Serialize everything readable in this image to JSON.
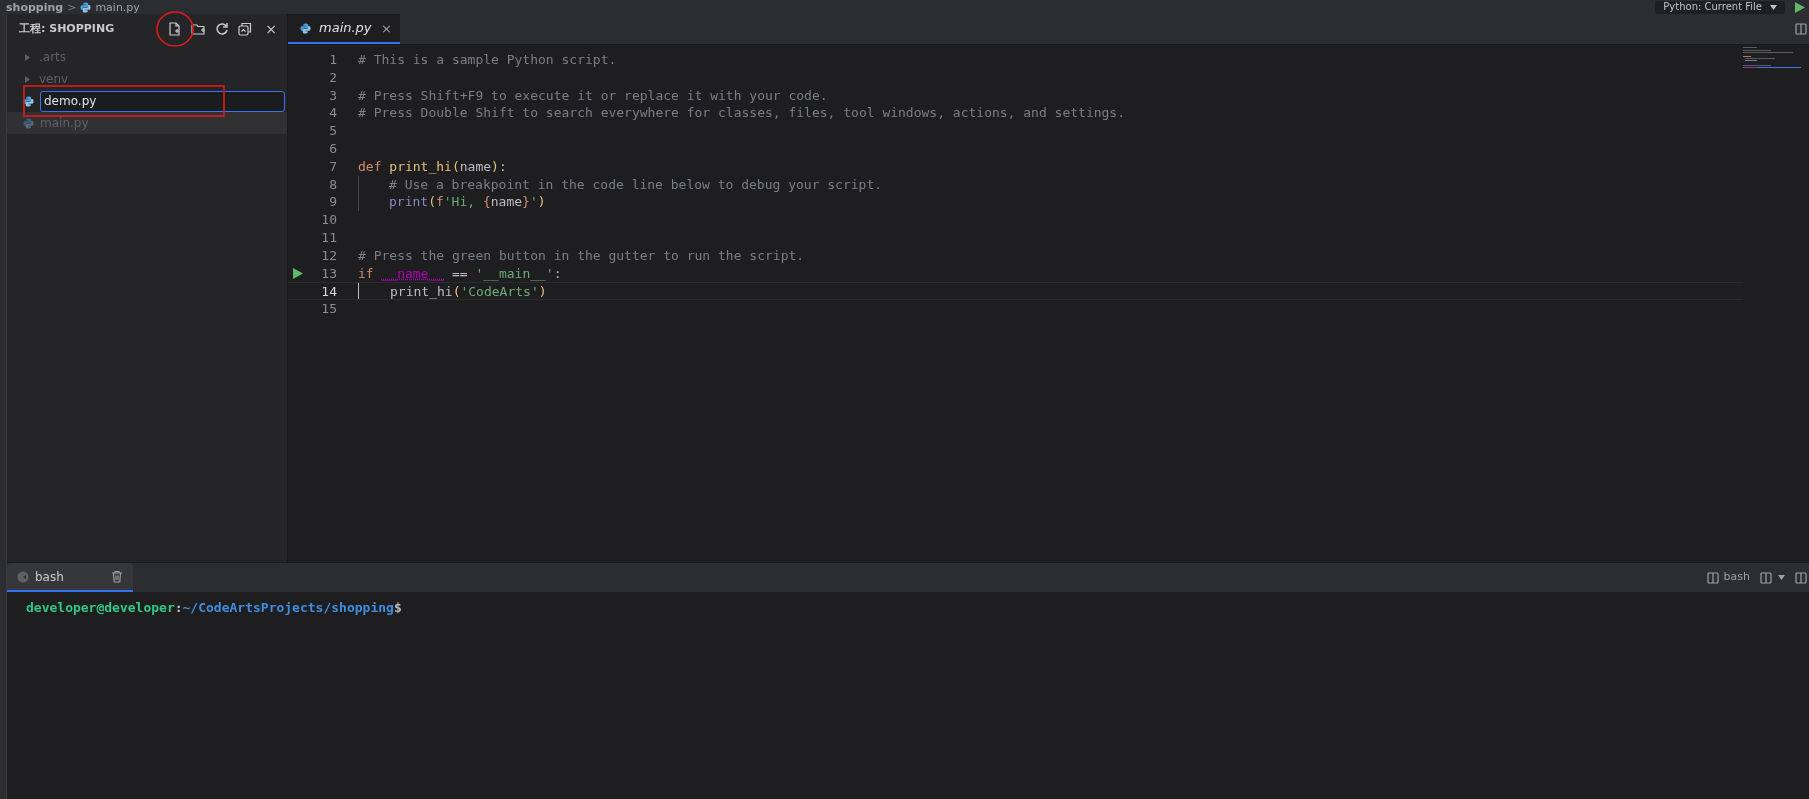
{
  "breadcrumb": {
    "folder": "shopping",
    "separator": ">",
    "file": "main.py"
  },
  "run_config": {
    "label": "Python: Current File"
  },
  "explorer": {
    "title": "工程: SHOPPING",
    "close": "×",
    "items": [
      {
        "kind": "folder",
        "name": ".arts",
        "selected": false
      },
      {
        "kind": "folder",
        "name": "venv",
        "selected": false
      },
      {
        "kind": "rename",
        "value": "demo.py",
        "selected": false
      },
      {
        "kind": "file",
        "name": "main.py",
        "selected": true
      }
    ]
  },
  "editor": {
    "tabs": [
      {
        "label": "main.py",
        "selected": true,
        "close": "×"
      }
    ],
    "lines": [
      {
        "number": "1",
        "current": false,
        "run_marker": false,
        "indented": false,
        "tokens": [
          {
            "kind": "comment",
            "text": "# This is a sample Python script."
          }
        ]
      },
      {
        "number": "2",
        "current": false,
        "run_marker": false
      },
      {
        "number": "3",
        "current": false,
        "run_marker": false,
        "indented": false,
        "tokens": [
          {
            "kind": "comment",
            "text": "# Press Shift+F9 to execute it or replace it with your code."
          }
        ]
      },
      {
        "number": "4",
        "current": false,
        "run_marker": false,
        "indented": false,
        "tokens": [
          {
            "kind": "comment",
            "text": "# Press Double Shift to search everywhere for classes, files, tool windows, actions, and settings."
          }
        ]
      },
      {
        "number": "5",
        "current": false,
        "run_marker": false
      },
      {
        "number": "6",
        "current": false,
        "run_marker": false
      },
      {
        "number": "7",
        "current": false,
        "run_marker": false,
        "indented": false,
        "tokens": [
          {
            "kind": "keyword",
            "text": "def "
          },
          {
            "kind": "function",
            "text": "print_hi"
          },
          {
            "kind": "paren",
            "text": "("
          },
          {
            "kind": "plain",
            "text": "name"
          },
          {
            "kind": "paren",
            "text": ")"
          },
          {
            "kind": "plain",
            "text": ":"
          }
        ]
      },
      {
        "number": "8",
        "current": false,
        "run_marker": false,
        "indented": true,
        "tokens": [
          {
            "kind": "comment",
            "text": "# Use a breakpoint in the code line below to debug your script."
          }
        ]
      },
      {
        "number": "9",
        "current": false,
        "run_marker": false,
        "indented": true,
        "tokens": [
          {
            "kind": "builtin",
            "text": "print"
          },
          {
            "kind": "paren",
            "text": "("
          },
          {
            "kind": "keyword",
            "text": "f"
          },
          {
            "kind": "string",
            "text": "'Hi, "
          },
          {
            "kind": "brace",
            "text": "{"
          },
          {
            "kind": "plain",
            "text": "name"
          },
          {
            "kind": "brace",
            "text": "}"
          },
          {
            "kind": "string",
            "text": "'"
          },
          {
            "kind": "paren",
            "text": ")"
          }
        ]
      },
      {
        "number": "10",
        "current": false,
        "run_marker": false
      },
      {
        "number": "11",
        "current": false,
        "run_marker": false
      },
      {
        "number": "12",
        "current": false,
        "run_marker": false,
        "indented": false,
        "tokens": [
          {
            "kind": "comment",
            "text": "# Press the green button in the gutter to run the script."
          }
        ]
      },
      {
        "number": "13",
        "current": false,
        "run_marker": true,
        "indented": false,
        "tokens": [
          {
            "kind": "keyword",
            "text": "if "
          },
          {
            "kind": "dunder",
            "text": "__name__"
          },
          {
            "kind": "plain",
            "text": " == "
          },
          {
            "kind": "string",
            "text": "'__main__'"
          },
          {
            "kind": "plain",
            "text": ":"
          }
        ]
      },
      {
        "number": "14",
        "current": true,
        "run_marker": false,
        "indented": true,
        "tokens": [
          {
            "kind": "plain",
            "text": "print_hi"
          },
          {
            "kind": "paren",
            "text": "("
          },
          {
            "kind": "string",
            "text": "'CodeArts'"
          },
          {
            "kind": "paren",
            "text": ")"
          }
        ]
      },
      {
        "number": "15",
        "current": false,
        "run_marker": false
      }
    ]
  },
  "terminal": {
    "tabs": [
      {
        "label": "bash",
        "selected": true
      }
    ],
    "toolbar_label": "bash",
    "prompt": {
      "user": "developer@developer",
      "colon": ":",
      "path": "~/CodeArtsProjects/shopping",
      "symbol": "$"
    }
  }
}
